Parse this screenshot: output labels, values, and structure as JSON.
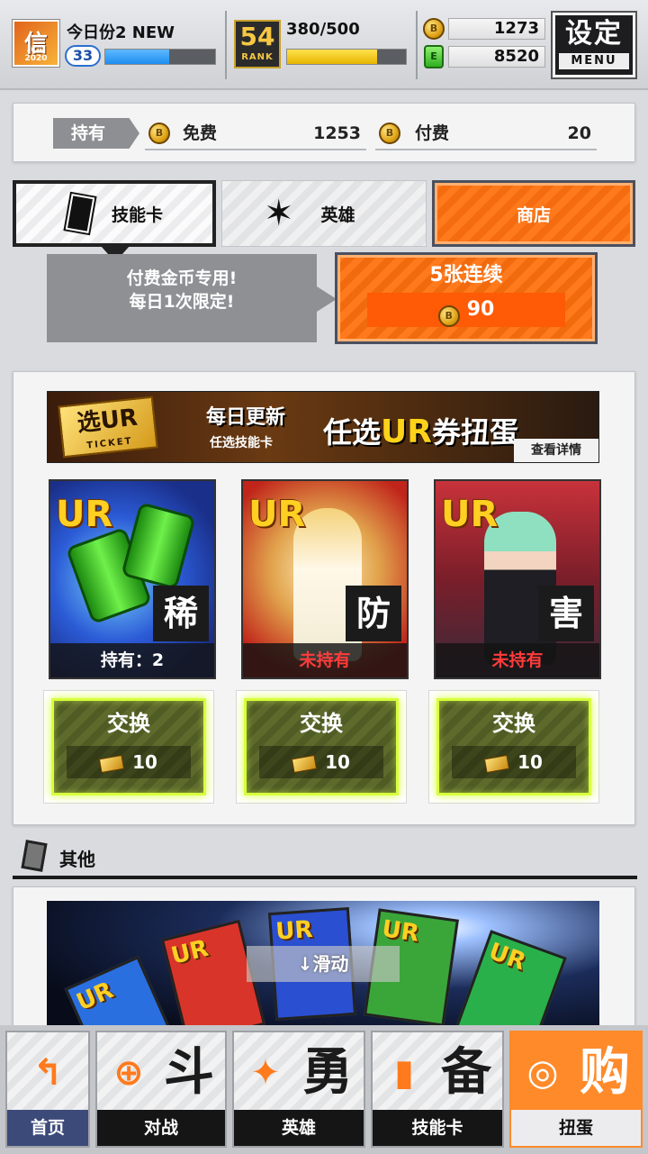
{
  "header": {
    "avatar_caption": "App 2020",
    "avatar_glyph": "信",
    "username": "今日份2 NEW",
    "level": "33",
    "xp_fraction": 0.58,
    "rank_number": "54",
    "rank_label": "RANK",
    "stamina": "380/500",
    "stamina_fraction": 0.76,
    "coin_icon_letter": "B",
    "gem_icon_letter": "E",
    "coins": "1273",
    "gems": "8520",
    "settings_label": "设定",
    "menu_label": "MENU"
  },
  "holdings": {
    "tag": "持有",
    "free_label": "免费",
    "free_value": "1253",
    "paid_label": "付费",
    "paid_value": "20"
  },
  "tabs": [
    {
      "label": "技能卡",
      "icon": "card-icon"
    },
    {
      "label": "英雄",
      "icon": "hero-icon"
    },
    {
      "label": "商店",
      "icon": ""
    }
  ],
  "gacha": {
    "info_line1": "付费金币专用!",
    "info_line2": "每日1次限定!",
    "pull_title": "5张连续",
    "pull_cost": "90"
  },
  "banner": {
    "ticket_text": "选UR",
    "ticket_sub": "TICKET",
    "daily": "每日更新",
    "pick_skill": "任选技能卡",
    "headline_pre": "任选",
    "headline_ur": "UR",
    "headline_post": "券扭蛋",
    "details": "查看详情"
  },
  "cards": [
    {
      "rarity": "UR",
      "type": "稀",
      "owned": "持有：2",
      "owned_none": false,
      "exchange_label": "交换",
      "price": "10"
    },
    {
      "rarity": "UR",
      "type": "防",
      "owned": "未持有",
      "owned_none": true,
      "exchange_label": "交换",
      "price": "10"
    },
    {
      "rarity": "UR",
      "type": "害",
      "owned": "未持有",
      "owned_none": true,
      "exchange_label": "交换",
      "price": "10"
    }
  ],
  "others": {
    "label": "其他",
    "scroll_hint": "↓滑动",
    "mini_card_label": "UR"
  },
  "nav": [
    {
      "label": "首页",
      "glyph": "",
      "icon_char": "↰",
      "icon": "home-icon"
    },
    {
      "label": "对战",
      "glyph": "斗",
      "icon_char": "⊕",
      "icon": "gamepad-icon"
    },
    {
      "label": "英雄",
      "glyph": "勇",
      "icon_char": "✦",
      "icon": "hero-icon"
    },
    {
      "label": "技能卡",
      "glyph": "备",
      "icon_char": "▮",
      "icon": "cards-icon"
    },
    {
      "label": "扭蛋",
      "glyph": "购",
      "icon_char": "◎",
      "icon": "gacha-icon"
    }
  ],
  "colors": {
    "accent_orange": "#ff7a1c",
    "exchange_glow": "#d8ff3c",
    "xp_blue": "#1d8ef0",
    "stamina_yellow": "#e7b500",
    "not_owned_red": "#ff3b3b"
  }
}
